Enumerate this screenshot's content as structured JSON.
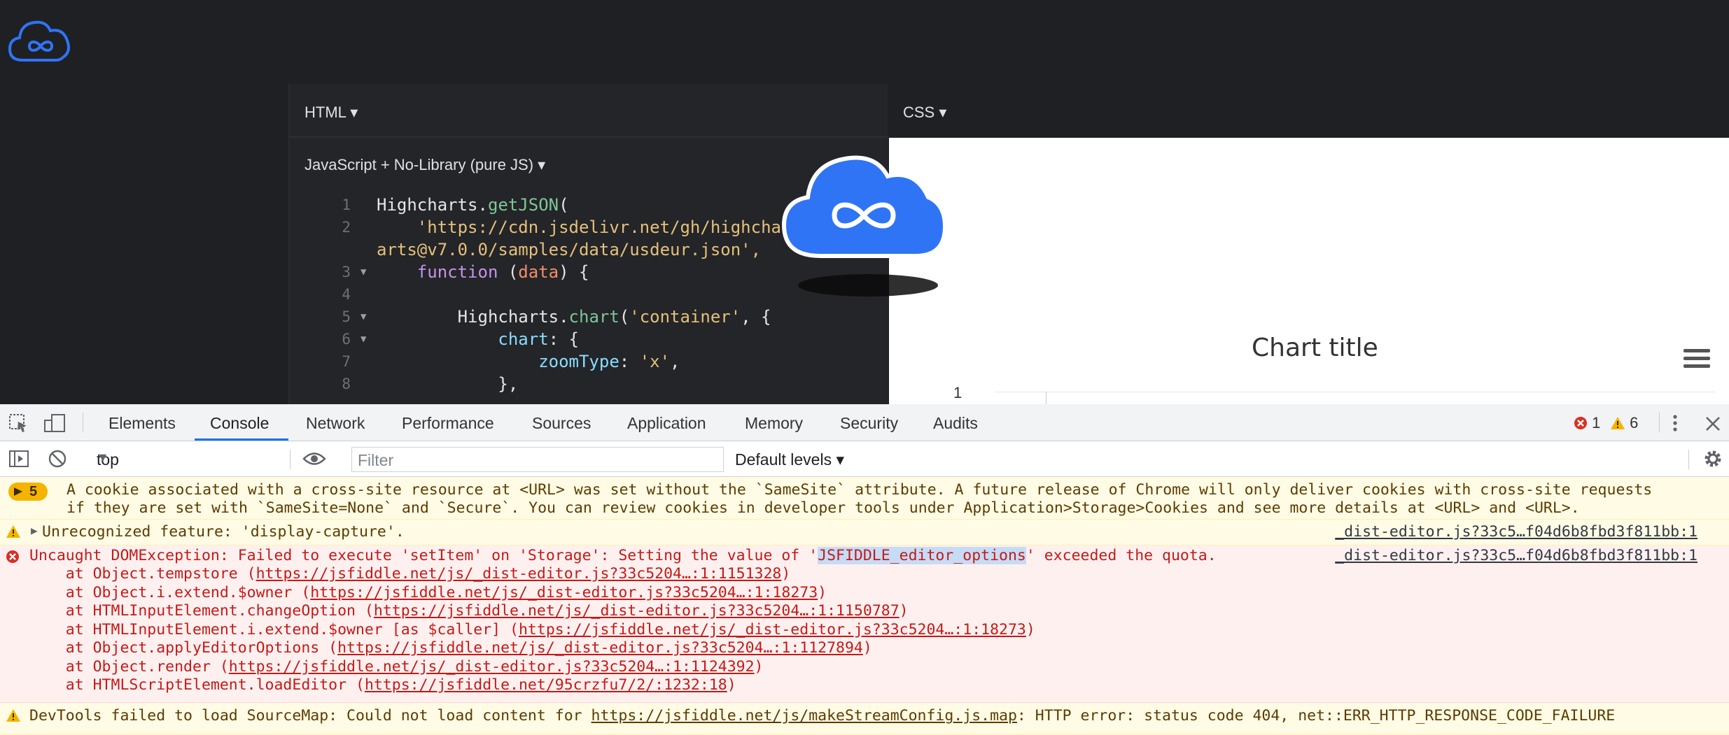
{
  "editor": {
    "html_label": "HTML",
    "css_label": "CSS",
    "js_label": "JavaScript + No-Library (pure JS)",
    "code_lines": [
      {
        "n": "1",
        "text": "Highcharts.getJSON("
      },
      {
        "n": "2",
        "text": "    'https://cdn.jsdelivr.net/gh/highcharts/highch"
      },
      {
        "n": "",
        "text": "arts@v7.0.0/samples/data/usdeur.json',"
      },
      {
        "n": "3",
        "text": "    function (data) {"
      },
      {
        "n": "4",
        "text": ""
      },
      {
        "n": "5",
        "text": "        Highcharts.chart('container', {"
      },
      {
        "n": "6",
        "text": "            chart: {"
      },
      {
        "n": "7",
        "text": "                zoomType: 'x',"
      },
      {
        "n": "8",
        "text": "            },"
      }
    ]
  },
  "result": {
    "chart_title": "Chart title",
    "y_tick": "1"
  },
  "devtools": {
    "tabs": [
      "Elements",
      "Console",
      "Network",
      "Performance",
      "Sources",
      "Application",
      "Memory",
      "Security",
      "Audits"
    ],
    "active_tab": "Console",
    "error_count": "1",
    "warning_count": "6",
    "context": "top",
    "filter_placeholder": "Filter",
    "levels": "Default levels",
    "messages": {
      "cookie_count": "5",
      "cookie_line1": "A cookie associated with a cross-site resource at <URL> was set without the `SameSite` attribute. A future release of Chrome will only deliver cookies with cross-site requests",
      "cookie_line2": "if they are set with `SameSite=None` and `Secure`. You can review cookies in developer tools under Application>Storage>Cookies and see more details at <URL> and <URL>.",
      "feature_warning": "Unrecognized feature: 'display-capture'.",
      "feature_source": "_dist-editor.js?33c5…f04d6b8fbd3f811bb:1",
      "error_prefix": "Uncaught DOMException: Failed to execute 'setItem' on 'Storage': Setting the value of '",
      "error_key": "JSFIDDLE_editor_options",
      "error_suffix": "' exceeded the quota.",
      "error_source": "_dist-editor.js?33c5…f04d6b8fbd3f811bb:1",
      "stack": [
        {
          "pre": "    at Object.tempstore (",
          "link": "https://jsfiddle.net/js/_dist-editor.js?33c5204…:1:1151328",
          "post": ")"
        },
        {
          "pre": "    at Object.i.extend.$owner (",
          "link": "https://jsfiddle.net/js/_dist-editor.js?33c5204…:1:18273",
          "post": ")"
        },
        {
          "pre": "    at HTMLInputElement.changeOption (",
          "link": "https://jsfiddle.net/js/_dist-editor.js?33c5204…:1:1150787",
          "post": ")"
        },
        {
          "pre": "    at HTMLInputElement.i.extend.$owner [as $caller] (",
          "link": "https://jsfiddle.net/js/_dist-editor.js?33c5204…:1:18273",
          "post": ")"
        },
        {
          "pre": "    at Object.applyEditorOptions (",
          "link": "https://jsfiddle.net/js/_dist-editor.js?33c5204…:1:1127894",
          "post": ")"
        },
        {
          "pre": "    at Object.render (",
          "link": "https://jsfiddle.net/js/_dist-editor.js?33c5204…:1:1124392",
          "post": ")"
        },
        {
          "pre": "    at HTMLScriptElement.loadEditor (",
          "link": "https://jsfiddle.net/95crzfu7/2/:1232:18",
          "post": ")"
        }
      ],
      "sourcemap_prefix": "DevTools failed to load SourceMap: Could not load content for ",
      "sourcemap_link": "https://jsfiddle.net/js/makeStreamConfig.js.map",
      "sourcemap_suffix": ": HTTP error: status code 404, net::ERR_HTTP_RESPONSE_CODE_FAILURE"
    }
  },
  "colors": {
    "accent": "#1a73e8",
    "error": "#c41a16",
    "warning": "#f4b400",
    "logo_blue": "#2f74f5"
  }
}
